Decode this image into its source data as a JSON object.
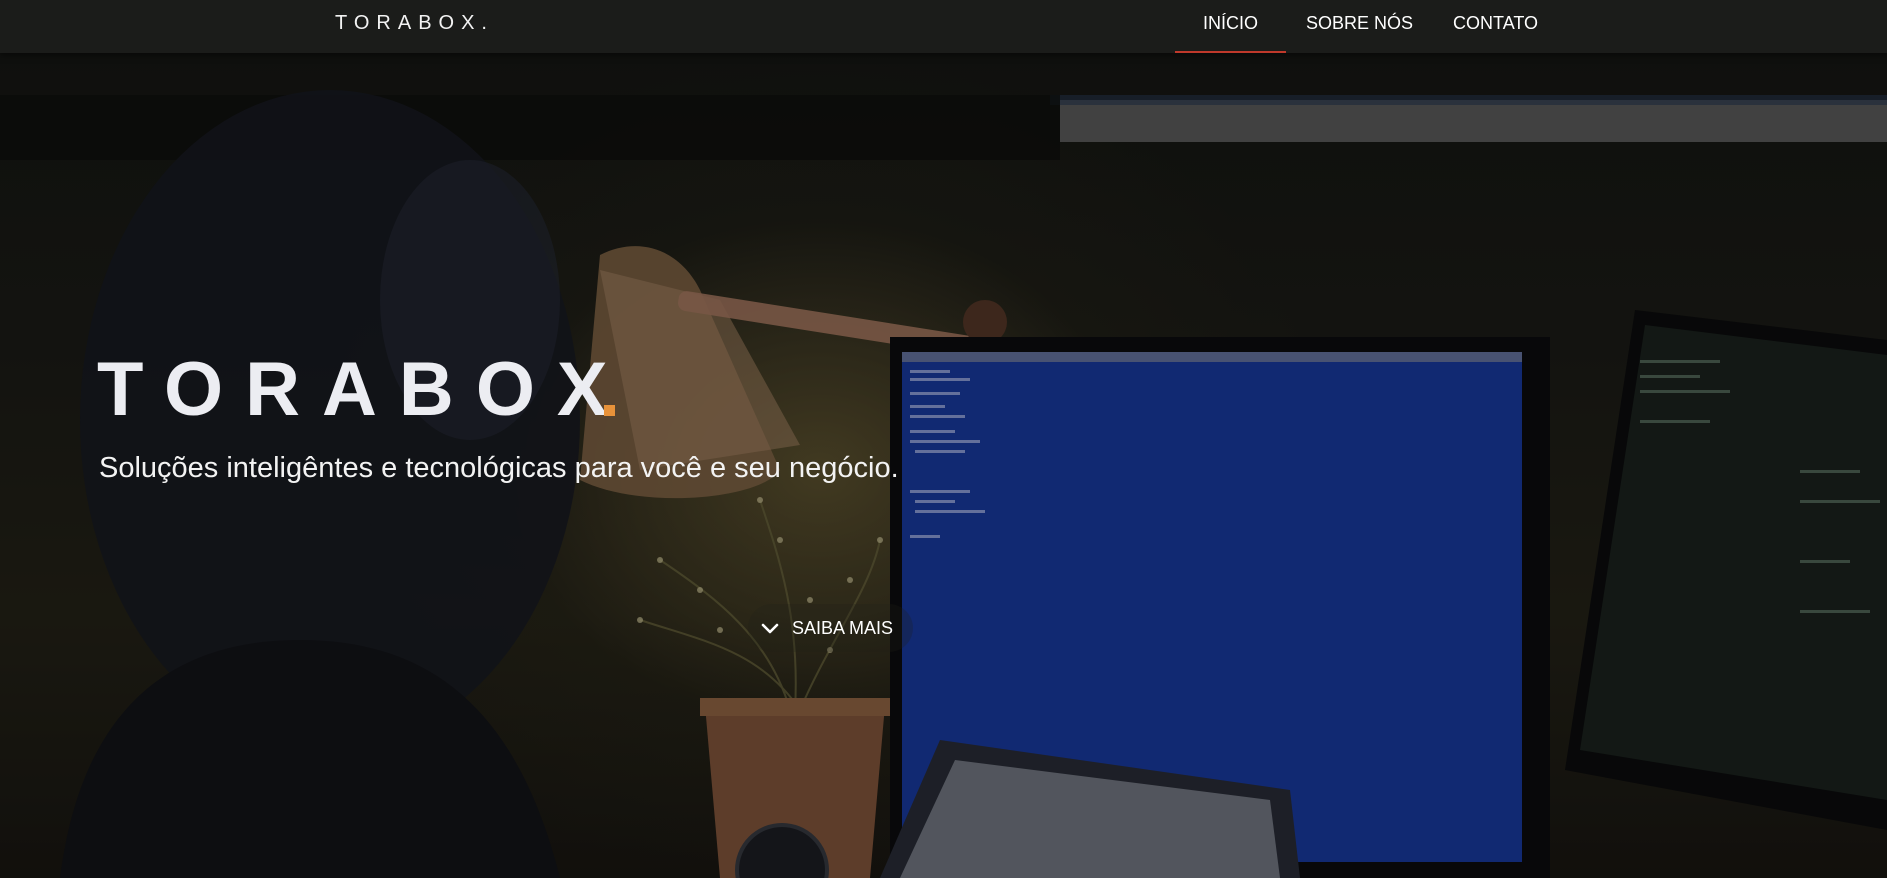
{
  "navbar": {
    "brand": "TORABOX.",
    "links": [
      {
        "label": "INÍCIO",
        "active": true
      },
      {
        "label": "SOBRE NÓS",
        "active": false
      },
      {
        "label": "CONTATO",
        "active": false
      }
    ]
  },
  "hero": {
    "title": "TORABOX",
    "subtitle": "Soluções inteligêntes e tecnológicas para você e seu negócio.",
    "cta_label": "SAIBA MAIS",
    "cta_icon": "chevron-down-icon"
  },
  "colors": {
    "navbar_bg": "#1b1c1a",
    "active_underline": "#c0392b",
    "accent_dot": "#e8923a",
    "monitor_screen": "#1a3da8"
  }
}
